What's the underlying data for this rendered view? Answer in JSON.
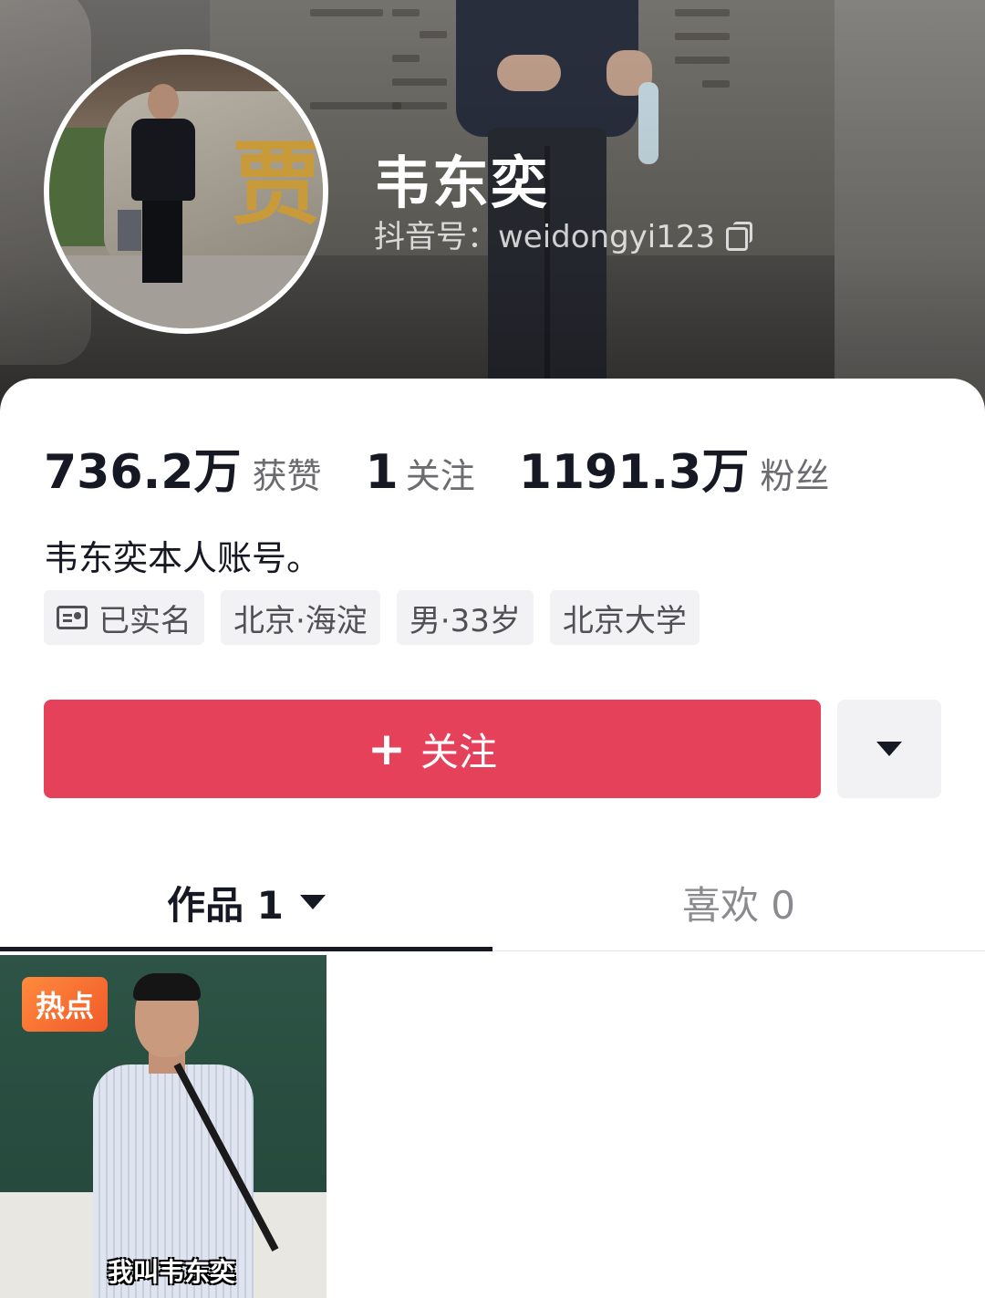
{
  "profile": {
    "nickname": "韦东奕",
    "douyin_id": "抖音号：weidongyi123",
    "bio": "韦东奕本人账号。"
  },
  "stats": {
    "likes_value": "736.2万",
    "likes_label": "获赞",
    "following_value": "1",
    "following_label": "关注",
    "followers_value": "1191.3万",
    "followers_label": "粉丝"
  },
  "tags": {
    "verified": "已实名",
    "location": "北京·海淀",
    "gender_age": "男·33岁",
    "school": "北京大学"
  },
  "actions": {
    "follow_label": "关注",
    "follow_plus": "+"
  },
  "tabs": {
    "works": "作品 1",
    "likes": "喜欢 0"
  },
  "video": {
    "badge": "热点",
    "caption": "我叫韦东奕"
  },
  "colors": {
    "follow_button": "#e6415a",
    "hot_badge": "#f26b30",
    "text_primary": "#161823",
    "text_secondary": "#6b6b70"
  },
  "icons": {
    "copy": "copy-icon",
    "id_card": "id-card-icon",
    "more": "chevron-down-icon"
  }
}
